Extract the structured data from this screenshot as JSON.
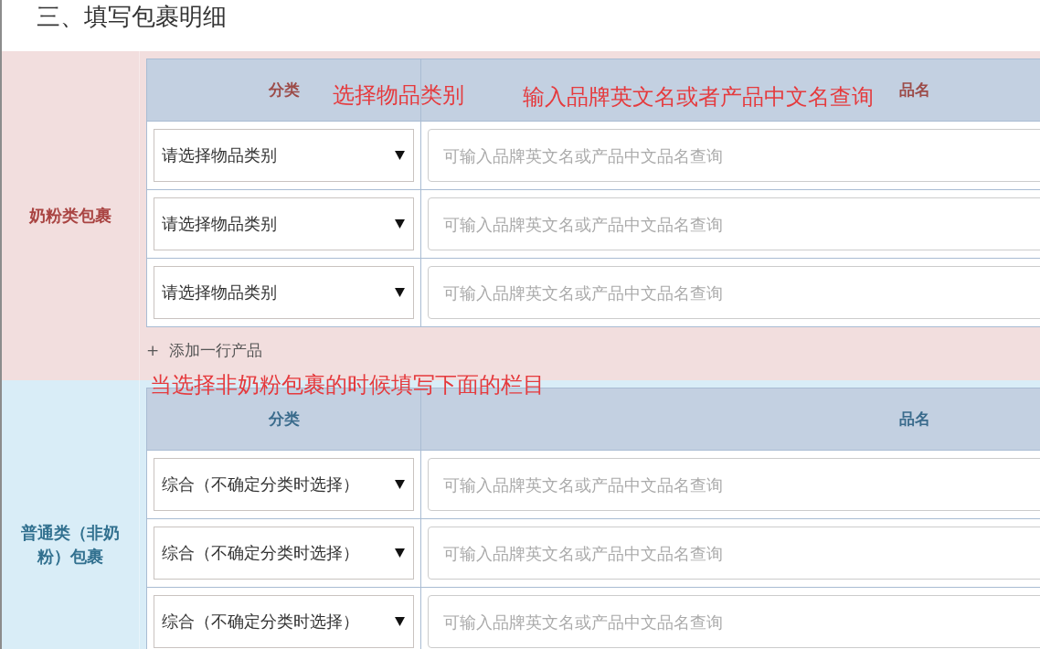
{
  "heading": "三、填写包裹明细",
  "sections": [
    {
      "kind": "milk",
      "label": "奶粉类包裹",
      "columns": [
        "分类",
        "品名"
      ],
      "rows": [
        {
          "category": "请选择物品类别",
          "placeholder": "可输入品牌英文名或产品中文品名查询"
        },
        {
          "category": "请选择物品类别",
          "placeholder": "可输入品牌英文名或产品中文品名查询"
        },
        {
          "category": "请选择物品类别",
          "placeholder": "可输入品牌英文名或产品中文品名查询"
        }
      ],
      "add_row": "+ 添加一行产品"
    },
    {
      "kind": "general",
      "label": "普通类（非奶粉）包裹",
      "columns": [
        "分类",
        "品名"
      ],
      "rows": [
        {
          "category": "综合（不确定分类时选择）",
          "placeholder": "可输入品牌英文名或产品中文品名查询"
        },
        {
          "category": "综合（不确定分类时选择）",
          "placeholder": "可输入品牌英文名或产品中文品名查询"
        },
        {
          "category": "综合（不确定分类时选择）",
          "placeholder": "可输入品牌英文名或产品中文品名查询"
        }
      ]
    }
  ],
  "annotations": [
    {
      "text": "选择物品类别"
    },
    {
      "text": "输入品牌英文名或者产品中文名查询"
    },
    {
      "text": "当选择非奶粉包裹的时候填写下面的栏目"
    }
  ]
}
